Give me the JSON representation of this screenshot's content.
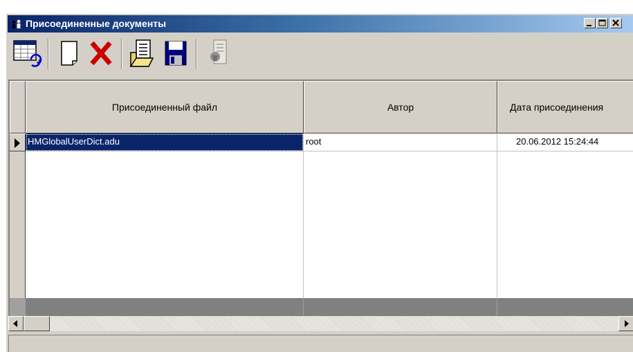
{
  "window": {
    "title": "Присоединенные документы",
    "minimize_icon": "minimize-icon",
    "maximize_icon": "maximize-icon",
    "close_icon": "close-icon"
  },
  "toolbar": {
    "buttons": [
      {
        "icon": "refresh-table-icon"
      },
      {
        "icon": "new-document-icon"
      },
      {
        "icon": "delete-icon",
        "color": "#cc0000"
      },
      {
        "icon": "open-document-icon"
      },
      {
        "icon": "save-icon",
        "color": "#00007f"
      },
      {
        "icon": "properties-disabled-icon",
        "disabled": true
      }
    ]
  },
  "grid": {
    "columns": [
      {
        "label": "Присоединенный файл"
      },
      {
        "label": "Автор"
      },
      {
        "label": "Дата присоединения"
      }
    ],
    "rows": [
      {
        "file": "HMGlobalUserDict.adu",
        "author": "root",
        "date": "20.06.2012 15:24:44",
        "selected": true
      }
    ]
  },
  "colors": {
    "window_bg": "#d4d0c8",
    "title_start": "#0a246a",
    "title_end": "#a6caf0",
    "selection_bg": "#0a246a",
    "footer_bg": "#808080"
  }
}
